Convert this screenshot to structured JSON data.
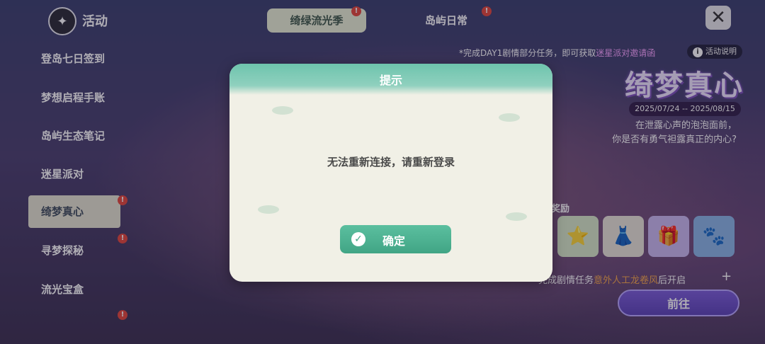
{
  "header": {
    "title": "活动",
    "tabs": [
      {
        "label": "绮绿流光季",
        "badge": "!"
      },
      {
        "label": "岛屿日常",
        "badge": "!"
      }
    ]
  },
  "sidebar": {
    "items": [
      {
        "label": "登岛七日签到"
      },
      {
        "label": "梦想启程手账"
      },
      {
        "label": "岛屿生态笔记"
      },
      {
        "label": "迷星派对"
      },
      {
        "label": "绮梦真心",
        "badge": "!"
      },
      {
        "label": "寻梦探秘",
        "badge": "!"
      },
      {
        "label": "流光宝盒",
        "badge": "!"
      }
    ]
  },
  "event": {
    "notice_prefix": "*完成DAY1剧情部分任务，即可获取",
    "notice_highlight": "迷星派对邀请函",
    "info_label": "活动说明",
    "logo_text": "绮梦真心",
    "date_range": "2025/07/24 -- 2025/08/15",
    "slogan_line1": "在泄露心声的泡泡面前，",
    "slogan_line2": "你是否有勇气袒露真正的内心?",
    "reward_label": "奖励",
    "task_prefix": "完成剧情任务",
    "task_highlight": "意外人工龙卷风",
    "task_suffix": "后开启",
    "goto_label": "前往"
  },
  "modal": {
    "title": "提示",
    "message": "无法重新连接，请重新登录",
    "confirm_label": "确定"
  },
  "colors": {
    "accent_green": "#41a585",
    "highlight_pink": "#f7a3ff",
    "highlight_orange": "#f7a84a",
    "badge_red": "#e4473b"
  }
}
